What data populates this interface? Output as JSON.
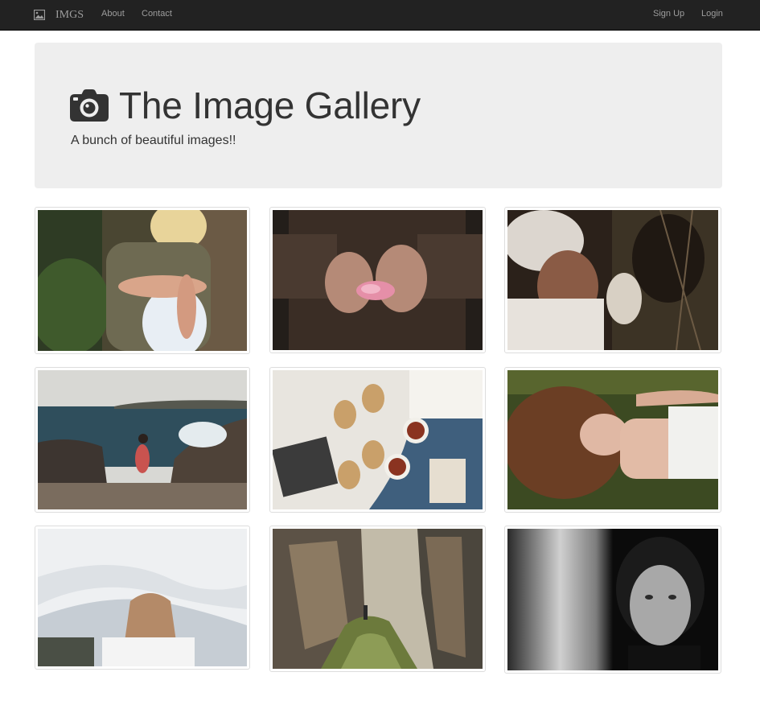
{
  "navbar": {
    "brand": "IMGS",
    "brand_icon": "picture-icon",
    "links": [
      {
        "label": "About"
      },
      {
        "label": "Contact"
      }
    ],
    "right_links": [
      {
        "label": "Sign Up"
      },
      {
        "label": "Login"
      }
    ]
  },
  "jumbotron": {
    "icon": "camera-icon",
    "title": "The Image Gallery",
    "subtitle": "A bunch of beautiful images!!"
  },
  "gallery": {
    "items": [
      {
        "name": "woman-knit-sweater-rings",
        "palette": [
          "#3b3a2c",
          "#6e6a52",
          "#d9cdb8",
          "#2e3b24"
        ]
      },
      {
        "name": "hands-holding-pink-flower",
        "palette": [
          "#2a241f",
          "#4a3a30",
          "#b28b78",
          "#e58fa8"
        ]
      },
      {
        "name": "women-winter-hats-forest",
        "palette": [
          "#2b211a",
          "#5a4a3e",
          "#e7e2dc",
          "#3c3325"
        ]
      },
      {
        "name": "girl-on-rocky-seashore",
        "palette": [
          "#d8d8d4",
          "#2f4e5c",
          "#5a5148",
          "#c9534f"
        ]
      },
      {
        "name": "tea-and-toast-picnic-flatlay",
        "palette": [
          "#3f5f7d",
          "#e8e5df",
          "#8a3320",
          "#c9a06a"
        ]
      },
      {
        "name": "woman-lying-in-grass",
        "palette": [
          "#3c4a22",
          "#7a4a2c",
          "#e0b8a4",
          "#f1f1ee"
        ]
      },
      {
        "name": "woman-under-white-fabric",
        "palette": [
          "#d9dde2",
          "#eef0f2",
          "#b48a68",
          "#b9c2ca"
        ]
      },
      {
        "name": "hiker-between-cliffs",
        "palette": [
          "#4b463d",
          "#8c7a62",
          "#c2bba9",
          "#6c7a3c"
        ]
      },
      {
        "name": "black-white-portrait",
        "palette": [
          "#0b0b0b",
          "#7d7d7d",
          "#d0d0d0",
          "#a8a8a8"
        ]
      }
    ]
  },
  "colors": {
    "navbar_bg": "#222222",
    "nav_text": "#9d9d9d",
    "jumbotron_bg": "#eeeeee",
    "text": "#333333",
    "thumb_border": "#dddddd"
  }
}
